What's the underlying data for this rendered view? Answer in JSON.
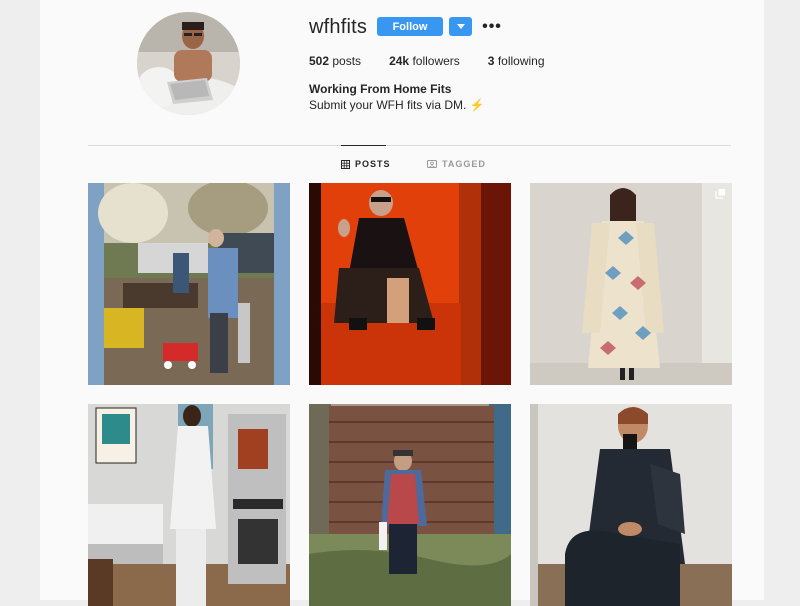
{
  "profile": {
    "username": "wfhfits",
    "follow_label": "Follow",
    "dropdown_icon": "chevron-down-icon",
    "more_label": "•••",
    "stats": {
      "posts_count": "502",
      "posts_label": "posts",
      "followers_count": "24k",
      "followers_label": "followers",
      "following_count": "3",
      "following_label": "following"
    },
    "bio_name": "Working From Home Fits",
    "bio_text": "Submit your WFH fits via DM.",
    "bio_emoji": "⚡"
  },
  "tabs": [
    {
      "label": "POSTS",
      "icon": "grid-icon",
      "active": true
    },
    {
      "label": "TAGGED",
      "icon": "tag-icon",
      "active": false
    }
  ],
  "posts": [
    {
      "description": "outdoor yard shoveling",
      "multi": false
    },
    {
      "description": "red room seated",
      "multi": false
    },
    {
      "description": "quilt coat",
      "multi": true
    },
    {
      "description": "white tee arcade",
      "multi": false
    },
    {
      "description": "flannel shed",
      "multi": false
    },
    {
      "description": "dark blanket mirror selfie",
      "multi": false
    }
  ],
  "colors": {
    "accent": "#3897f0",
    "text": "#262626",
    "muted": "#999999",
    "background": "#fafafa"
  }
}
